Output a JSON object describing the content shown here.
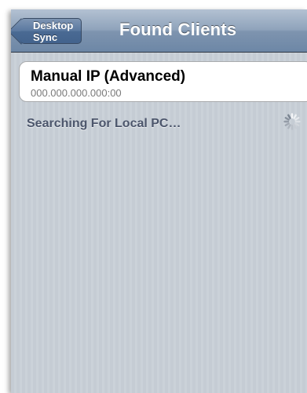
{
  "navbar": {
    "back_label": "Desktop Sync",
    "title": "Found Clients"
  },
  "manual_ip": {
    "title": "Manual IP (Advanced)",
    "subtitle": "000.000.000.000:00"
  },
  "status": {
    "text": "Searching For Local PC…",
    "activity": "activity-spinner-icon"
  },
  "colors": {
    "nav_bar": "#8fa3bb",
    "background_stripes": "#c5ccd4",
    "status_text": "#4c566c"
  }
}
